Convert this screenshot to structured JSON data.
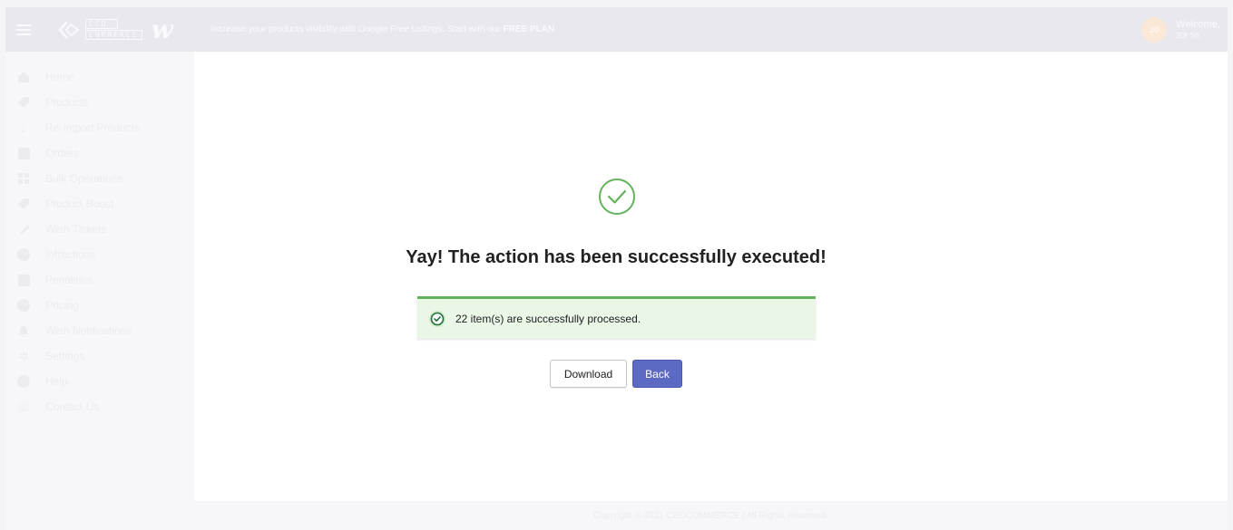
{
  "header": {
    "logo_line1": "CED",
    "logo_line2": "COMMERCE",
    "wish_logo": "w",
    "announcement_text": "Increase your products visibility with Google Free Listings. Start with our ",
    "announcement_highlight": "FREE PLAN",
    "avatar_initials": "20",
    "welcome_label": "Welcome,",
    "user_name": "20t Sh"
  },
  "sidebar": {
    "items": [
      {
        "label": "Home",
        "icon": "home-icon"
      },
      {
        "label": "Products",
        "icon": "tag-icon"
      },
      {
        "label": "Re-Import Products",
        "icon": "arrow-down-icon"
      },
      {
        "label": "Orders",
        "icon": "inbox-icon"
      },
      {
        "label": "Bulk Operations",
        "icon": "grid-icon"
      },
      {
        "label": "Product Boost",
        "icon": "tag-icon"
      },
      {
        "label": "Wish Tickets",
        "icon": "ticket-icon"
      },
      {
        "label": "Infractions",
        "icon": "info-icon"
      },
      {
        "label": "Penalities",
        "icon": "receipt-icon"
      },
      {
        "label": "Pricing",
        "icon": "dollar-icon"
      },
      {
        "label": "Wish Notifications",
        "icon": "bell-icon"
      },
      {
        "label": "Settings",
        "icon": "gear-icon"
      },
      {
        "label": "Help",
        "icon": "help-icon"
      },
      {
        "label": "Contact Us",
        "icon": "phone-icon"
      }
    ]
  },
  "main": {
    "headline": "Yay! The action has been successfully executed!",
    "banner_text": "22 item(s) are successfully processed.",
    "download_label": "Download",
    "back_label": "Back"
  },
  "footer": {
    "copyright": "Copyright © 2021 CEDCOMMERCE | All Rights Reserved."
  },
  "colors": {
    "success_green": "#62b35c",
    "banner_bg": "#eaf6e6",
    "primary": "#5c6ac4"
  }
}
